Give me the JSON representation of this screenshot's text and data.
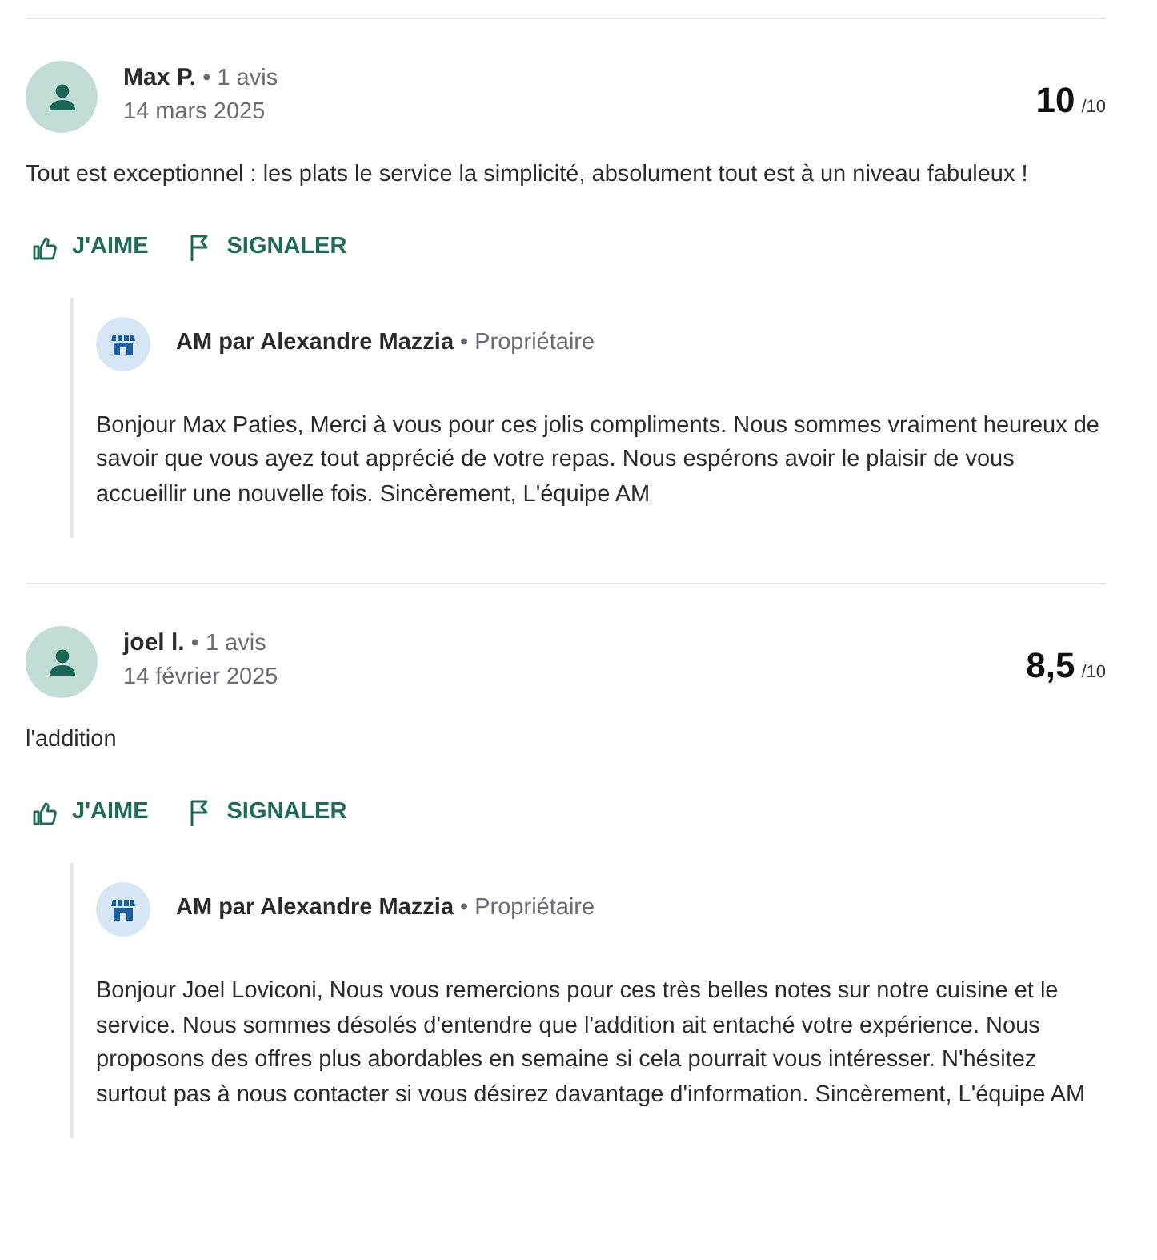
{
  "reviews": [
    {
      "author": "Max P.",
      "review_count": "• 1 avis",
      "date": "14 mars 2025",
      "score": "10",
      "score_max": "/10",
      "text": "Tout est exceptionnel : les plats le service la simplicité, absolument tout est à un niveau fabuleux !",
      "actions": [
        {
          "kind": "like",
          "label": "J'AIME"
        },
        {
          "kind": "report",
          "label": "SIGNALER"
        }
      ],
      "reply": {
        "name": "AM par Alexandre Mazzia",
        "role": "• Propriétaire",
        "text": "Bonjour Max Paties, Merci à vous pour ces jolis compliments. Nous sommes vraiment heureux de savoir que vous ayez tout apprécié de votre repas. Nous espérons avoir le plaisir de vous accueillir une nouvelle fois. Sincèrement, L'équipe AM"
      }
    },
    {
      "author": "joel l.",
      "review_count": "• 1 avis",
      "date": "14 février 2025",
      "score": "8,5",
      "score_max": "/10",
      "text": "l'addition",
      "actions": [
        {
          "kind": "like",
          "label": "J'AIME"
        },
        {
          "kind": "report",
          "label": "SIGNALER"
        }
      ],
      "reply": {
        "name": "AM par Alexandre Mazzia",
        "role": "• Propriétaire",
        "text": "Bonjour Joel Loviconi, Nous vous remercions pour ces très belles notes sur notre cuisine et le service. Nous sommes désolés d'entendre que l'addition ait entaché votre expérience. Nous proposons des offres plus abordables en semaine si cela pourrait vous intéresser. N'hésitez surtout pas à nous contacter si vous désirez davantage d'information. Sincèrement, L'équipe AM"
      }
    }
  ]
}
